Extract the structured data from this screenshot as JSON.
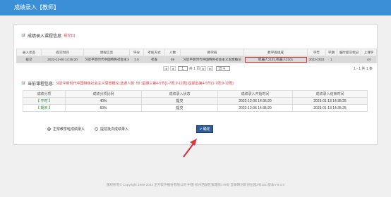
{
  "app": {
    "title": "成绩录入【教师】"
  },
  "course_info": {
    "heading": "成绩录入课程信息:",
    "status": "提交[1]",
    "columns": [
      "录入状态",
      "提交时间",
      "课程信息",
      "学分",
      "考核方式",
      "人数",
      "教学班",
      "教学班组成",
      "学年",
      "学期",
      "临时提交标记",
      "上课学"
    ],
    "row": [
      "提交",
      "2022-12-06 14:35:20",
      "习近平新时代中国特色社会主义思想概论",
      "3.0",
      "考查",
      "59",
      "习近平新时代中国特色社会主义思想概论",
      "机器人2101,机器人2101",
      "2022-2023",
      "1",
      "",
      "44"
    ]
  },
  "pager": {
    "page": "1",
    "of_text": "共 1 页",
    "page_size": "15",
    "info": "1 - 1 共 1 条"
  },
  "current": {
    "heading": "当前课程信息:",
    "detail": "习近平新时代中国特色社会主义思想概论;选课人数: 59 ;星期三第4-5节{1-7周,9-12周};星期五第4-5节{1-7周,9-12周}",
    "columns": [
      "成绩分项",
      "成绩分项比例",
      "成绩录入状态",
      "成绩录入开始时间",
      "成绩录入结束时间"
    ],
    "rows": [
      [
        "【 平时 】",
        "40%",
        "提交",
        "2022-12-06 14:35:20",
        "2023-01-13 14:35:25"
      ],
      [
        "【 期末 】",
        "60%",
        "提交",
        "2022-12-06 14:35:20",
        "2023-01-13 14:35:25"
      ]
    ]
  },
  "options": {
    "radio1": "正常教学班成绩录入",
    "radio2": "提前批次成绩录入",
    "confirm": "确定"
  },
  "footer": {
    "text": "版权所有© Copyright 1999-2022 正方软件股份有限公司    中国·杭州西湖区紫霞街176号 互联网创新创业园2号301    版本V-8.0.0"
  },
  "colors": {
    "titlebar": "#3a8fd6",
    "highlight": "#d9363e",
    "confirm": "#2f5e96",
    "category": "#1e8c2e"
  }
}
